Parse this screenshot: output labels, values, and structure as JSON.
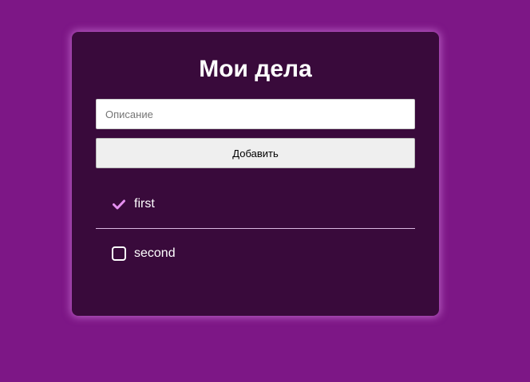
{
  "app": {
    "title": "Мои дела"
  },
  "form": {
    "input_placeholder": "Описание",
    "input_value": "",
    "add_label": "Добавить"
  },
  "todos": [
    {
      "label": "first",
      "done": true,
      "icon": "checkmark-icon"
    },
    {
      "label": "second",
      "done": false,
      "icon": "checkbox-icon"
    }
  ],
  "colors": {
    "page_background": "#7d1786",
    "card_background": "#390a3b",
    "check_accent": "#e58ff0",
    "divider": "#d9b8e0"
  }
}
